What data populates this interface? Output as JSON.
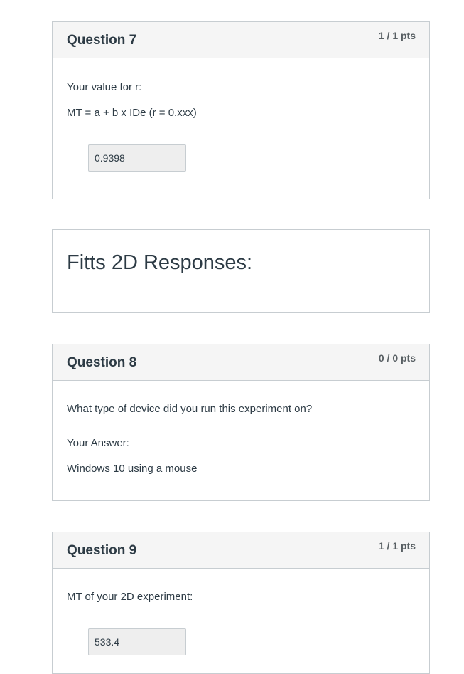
{
  "question7": {
    "title": "Question 7",
    "points": "1 / 1 pts",
    "prompt": "Your value for r:",
    "formula": "MT = a + b x IDe (r = 0.xxx)",
    "answer": "0.9398"
  },
  "section": {
    "title": "Fitts 2D Responses:"
  },
  "question8": {
    "title": "Question 8",
    "points": "0 / 0 pts",
    "prompt": "What type of device did you run this experiment on?",
    "answer_label": "Your Answer:",
    "answer": "Windows 10 using a mouse"
  },
  "question9": {
    "title": "Question 9",
    "points": "1 / 1 pts",
    "prompt": "MT of your 2D experiment:",
    "answer": "533.4"
  }
}
